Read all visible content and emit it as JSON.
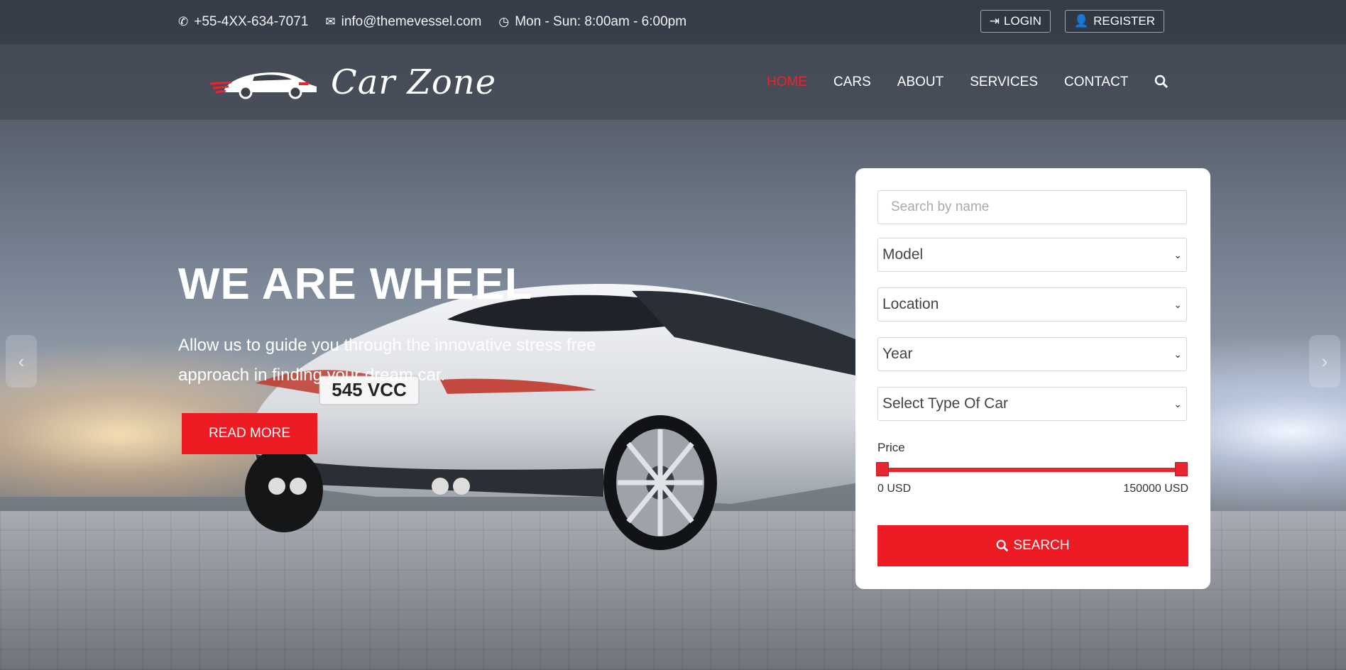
{
  "topbar": {
    "phone": "+55-4XX-634-7071",
    "email": "info@themevessel.com",
    "hours": "Mon - Sun: 8:00am - 6:00pm",
    "login_label": "LOGIN",
    "register_label": "REGISTER"
  },
  "header": {
    "logo_text": "Car Zone",
    "nav": [
      {
        "label": "HOME",
        "active": true
      },
      {
        "label": "CARS"
      },
      {
        "label": "ABOUT"
      },
      {
        "label": "SERVICES"
      },
      {
        "label": "CONTACT"
      }
    ]
  },
  "hero": {
    "title": "WE ARE WHEEL",
    "subtitle": "Allow us to guide you through the innovative stress free approach in finding your dream car.",
    "cta_label": "READ MORE",
    "plate": "545 VCC"
  },
  "search_form": {
    "name_placeholder": "Search by name",
    "selects": [
      "Model",
      "Location",
      "Year",
      "Select Type Of Car"
    ],
    "price_label": "Price",
    "price_min": "0 USD",
    "price_max": "150000 USD",
    "search_label": "SEARCH"
  },
  "colors": {
    "accent": "#ed1c24",
    "nav_active": "#e8262f"
  }
}
